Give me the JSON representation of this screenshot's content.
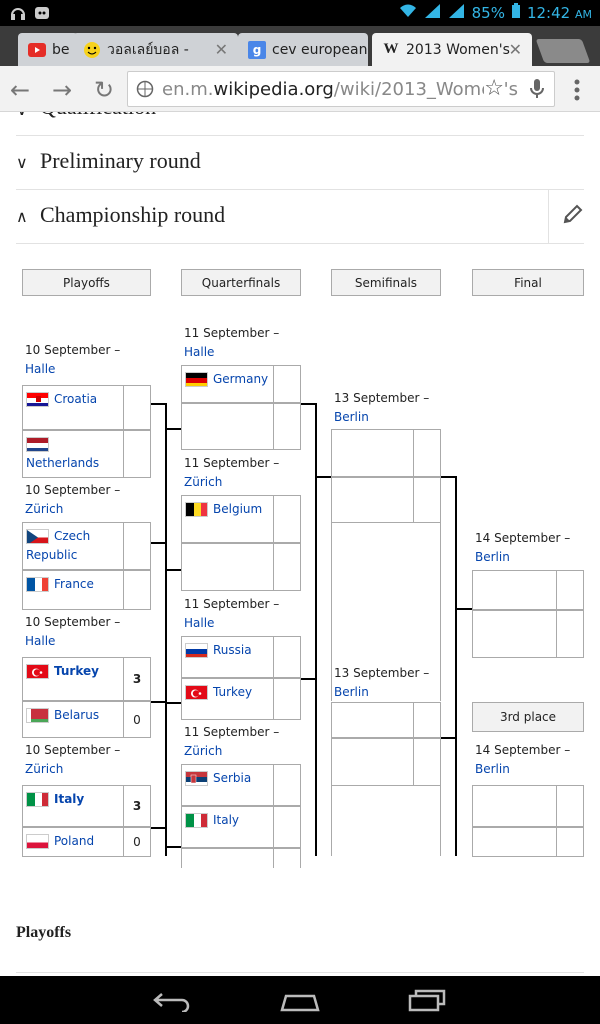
{
  "status": {
    "battery": "85%",
    "time": "12:42",
    "ampm": "AM"
  },
  "tabs": [
    {
      "title": "be",
      "favicon": "youtube-icon"
    },
    {
      "title": "วอลเลย์บอล -",
      "favicon": "smiley-icon"
    },
    {
      "title": "cev european",
      "favicon": "google-icon"
    },
    {
      "title": "2013 Women's",
      "favicon": "wikipedia-icon"
    }
  ],
  "url": {
    "prefix": "en.m.",
    "domain": "wikipedia.org",
    "path": "/wiki/2013_Women's"
  },
  "sections": {
    "cut": "Qualification",
    "prelim": "Preliminary round",
    "champ": "Championship round"
  },
  "headers": {
    "playoffs": "Playoffs",
    "quarter": "Quarterfinals",
    "semi": "Semifinals",
    "final": "Final"
  },
  "po_dates": [
    {
      "date": "10 September –",
      "venue": "Halle"
    },
    {
      "date": "10 September –",
      "venue": "Zürich"
    },
    {
      "date": "10 September –",
      "venue": "Halle"
    },
    {
      "date": "10 September –",
      "venue": "Zürich"
    }
  ],
  "qf_dates": [
    {
      "date": "11 September –",
      "venue": "Halle"
    },
    {
      "date": "11 September –",
      "venue": "Zürich"
    },
    {
      "date": "11 September –",
      "venue": "Halle"
    },
    {
      "date": "11 September –",
      "venue": "Zürich"
    }
  ],
  "sf_dates": [
    {
      "date": "13 September –",
      "venue": "Berlin"
    },
    {
      "date": "13 September –",
      "venue": "Berlin"
    }
  ],
  "final_dates": [
    {
      "date": "14 September –",
      "venue": "Berlin"
    },
    {
      "date": "14 September –",
      "venue": "Berlin"
    }
  ],
  "third_place": "3rd place",
  "po_teams": [
    {
      "name": "Croatia",
      "score": ""
    },
    {
      "name": "Netherlands",
      "score": ""
    },
    {
      "name": "Czech Republic",
      "score": ""
    },
    {
      "name": "France",
      "score": ""
    },
    {
      "name": "Turkey",
      "score": "3"
    },
    {
      "name": "Belarus",
      "score": "0"
    },
    {
      "name": "Italy",
      "score": "3"
    },
    {
      "name": "Poland",
      "score": "0"
    }
  ],
  "qf_teams": [
    {
      "name": "Germany"
    },
    {
      "name": ""
    },
    {
      "name": "Belgium"
    },
    {
      "name": ""
    },
    {
      "name": "Russia"
    },
    {
      "name": "Turkey"
    },
    {
      "name": "Serbia"
    },
    {
      "name": "Italy"
    }
  ],
  "next_heading": "Playoffs"
}
